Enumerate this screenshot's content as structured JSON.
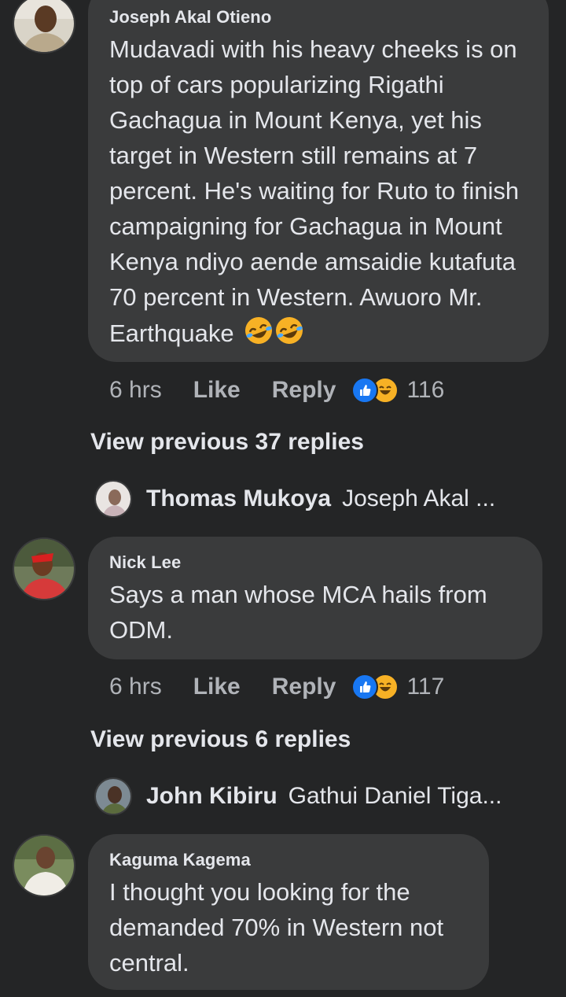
{
  "comments": [
    {
      "author": "Joseph Akal Otieno",
      "text": "Mudavadi with his heavy cheeks is on top of cars popularizing Rigathi Gachagua in Mount Kenya, yet his target in Western still remains at 7 percent. He's waiting for Ruto to finish campaigning for Gachagua in Mount Kenya ndiyo aende amsaidie kutafuta 70 percent in Western. Awuoro Mr. Earthquake",
      "emoji": "rolling-on-floor-laughing x2",
      "time": "6 hrs",
      "like_label": "Like",
      "reply_label": "Reply",
      "reactions": [
        "like",
        "haha"
      ],
      "reaction_count": "116",
      "view_previous": "View previous 37 replies",
      "latest_reply": {
        "name": "Thomas Mukoya",
        "text": "Joseph Akal ..."
      }
    },
    {
      "author": "Nick Lee",
      "text": "Says a man whose MCA hails from ODM.",
      "time": "6 hrs",
      "like_label": "Like",
      "reply_label": "Reply",
      "reactions": [
        "like",
        "haha"
      ],
      "reaction_count": "117",
      "view_previous": "View previous 6 replies",
      "latest_reply": {
        "name": "John Kibiru",
        "text": "Gathui Daniel Tiga..."
      }
    },
    {
      "author": "Kaguma Kagema",
      "text": "I thought you looking for the demanded 70% in Western not central."
    }
  ],
  "colors": {
    "background": "#242526",
    "bubble": "#3a3b3c",
    "text": "#e4e6eb",
    "meta": "#b0b3b8",
    "like_blue": "#1877f2",
    "haha_yellow": "#f7b125"
  }
}
